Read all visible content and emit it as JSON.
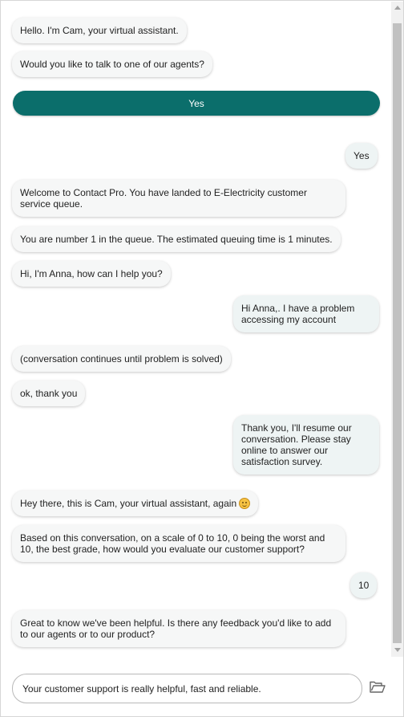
{
  "messages": [
    {
      "from": "bot",
      "text": "Hello. I'm Cam, your virtual assistant."
    },
    {
      "from": "bot",
      "text": "Would you like to talk to one of our agents?"
    },
    {
      "from": "user",
      "text": "Yes"
    },
    {
      "from": "bot",
      "text": "Welcome to Contact Pro. You have landed to E-Electricity customer service queue."
    },
    {
      "from": "bot",
      "text": "You are number 1 in the queue. The estimated queuing time is 1 minutes."
    },
    {
      "from": "agent",
      "text": "Hi, I'm Anna, how can I help you?"
    },
    {
      "from": "user",
      "text": "Hi Anna,. I have a problem accessing my account"
    },
    {
      "from": "agent",
      "text": "(conversation continues until problem is solved)"
    },
    {
      "from": "agent",
      "text": "ok, thank you"
    },
    {
      "from": "user",
      "text": "Thank you, I'll resume our conversation. Please stay online to answer our satisfaction survey."
    },
    {
      "from": "bot",
      "text": "Hey there, this is Cam, your virtual assistant, again",
      "icon": "smiley-icon"
    },
    {
      "from": "bot",
      "text": "Based on this conversation, on a scale of 0 to 10, 0 being the worst and 10, the best grade, how would you evaluate our customer support?"
    },
    {
      "from": "user",
      "text": "10"
    },
    {
      "from": "bot",
      "text": "Great to know we've been helpful. Is there any feedback you'd like to add to our agents or to our product?"
    }
  ],
  "quick_reply": {
    "label": "Yes"
  },
  "composer": {
    "value": "Your customer support is really helpful, fast and reliable.",
    "attach_icon": "folder-open-icon"
  },
  "colors": {
    "accent": "#0b6e6b",
    "bot_bubble": "#f6f7f7",
    "user_bubble": "#eef4f4"
  }
}
